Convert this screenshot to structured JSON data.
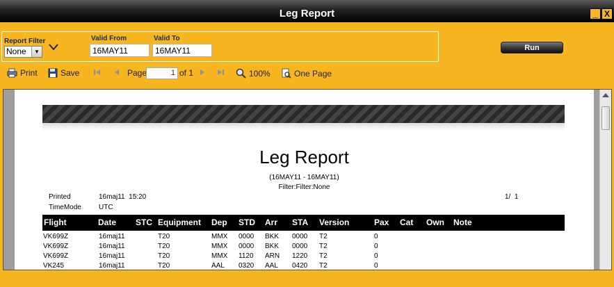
{
  "window": {
    "title": "Leg Report",
    "minimize_label": "_",
    "close_label": "X"
  },
  "filter": {
    "report_filter_label": "Report Filter",
    "report_filter_value": "None",
    "valid_from_label": "Valid From",
    "valid_from_value": "16MAY11",
    "valid_to_label": "Valid To",
    "valid_to_value": "16MAY11",
    "run_label": "Run"
  },
  "toolbar": {
    "print_label": "Print",
    "save_label": "Save",
    "page_label": "Page",
    "page_value": "1",
    "page_of": "of 1",
    "zoom_label": "100%",
    "one_page_label": "One Page"
  },
  "report": {
    "title": "Leg Report",
    "date_range": "(16MAY11 - 16MAY11)",
    "filter_line": "Filter:Filter:None",
    "printed_label": "Printed",
    "printed_value": "16maj11  15:20",
    "page_count": "1/  1",
    "timemode_label": "TimeMode",
    "timemode_value": "UTC",
    "columns": [
      "Flight",
      "Date",
      "STC",
      "Equipment",
      "Dep",
      "STD",
      "Arr",
      "STA",
      "Version",
      "Pax",
      "Cat",
      "Own",
      "Note"
    ],
    "rows": [
      [
        "VK699Z",
        "16maj11",
        "",
        "T20",
        "MMX",
        "0000",
        "BKK",
        "0000",
        "T2",
        "0",
        "",
        "",
        ""
      ],
      [
        "VK699Z",
        "16maj11",
        "",
        "T20",
        "MMX",
        "0000",
        "BKK",
        "0000",
        "T2",
        "0",
        "",
        "",
        ""
      ],
      [
        "VK699Z",
        "16maj11",
        "",
        "T20",
        "MMX",
        "1120",
        "ARN",
        "1220",
        "T2",
        "0",
        "",
        "",
        ""
      ],
      [
        "VK245",
        "16maj11",
        "",
        "T20",
        "AAL",
        "0320",
        "AAL",
        "0420",
        "T2",
        "0",
        "",
        "",
        ""
      ]
    ]
  }
}
